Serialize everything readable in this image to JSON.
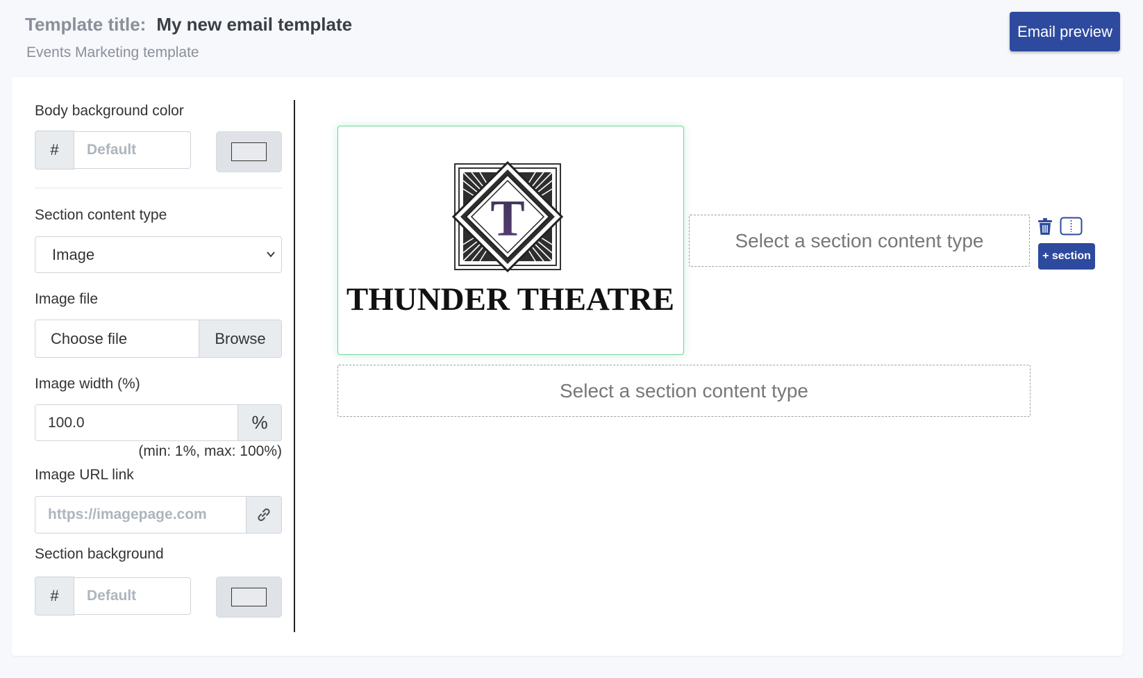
{
  "header": {
    "title_label": "Template title:",
    "title_value": "My new email template",
    "subtitle": "Events Marketing template",
    "preview_button": "Email preview"
  },
  "sidebar": {
    "body_bg": {
      "label": "Body background color",
      "prefix": "#",
      "placeholder": "Default",
      "swatch_color": "#e8eaed"
    },
    "content_type": {
      "label": "Section content type",
      "selected": "Image"
    },
    "image_file": {
      "label": "Image file",
      "text": "Choose file",
      "browse": "Browse"
    },
    "image_width": {
      "label": "Image width (%)",
      "value": "100.0",
      "suffix": "%",
      "hint": "(min: 1%, max: 100%)"
    },
    "image_url": {
      "label": "Image URL link",
      "placeholder": "https://imagepage.com",
      "icon": "link-icon"
    },
    "section_bg": {
      "label": "Section background",
      "prefix": "#",
      "placeholder": "Default",
      "swatch_color": "#e8eaed"
    }
  },
  "canvas": {
    "logo_letter": "T",
    "logo_text": "THUNDER THEATRE",
    "placeholder_right": "Select a section content type",
    "placeholder_bottom": "Select a section content type",
    "add_section": "+ section",
    "icons": [
      "trash-icon",
      "columns-icon"
    ]
  },
  "colors": {
    "primary": "#2e4a9e",
    "selected_border": "#6fd39a",
    "muted_text": "#8a8f99"
  }
}
